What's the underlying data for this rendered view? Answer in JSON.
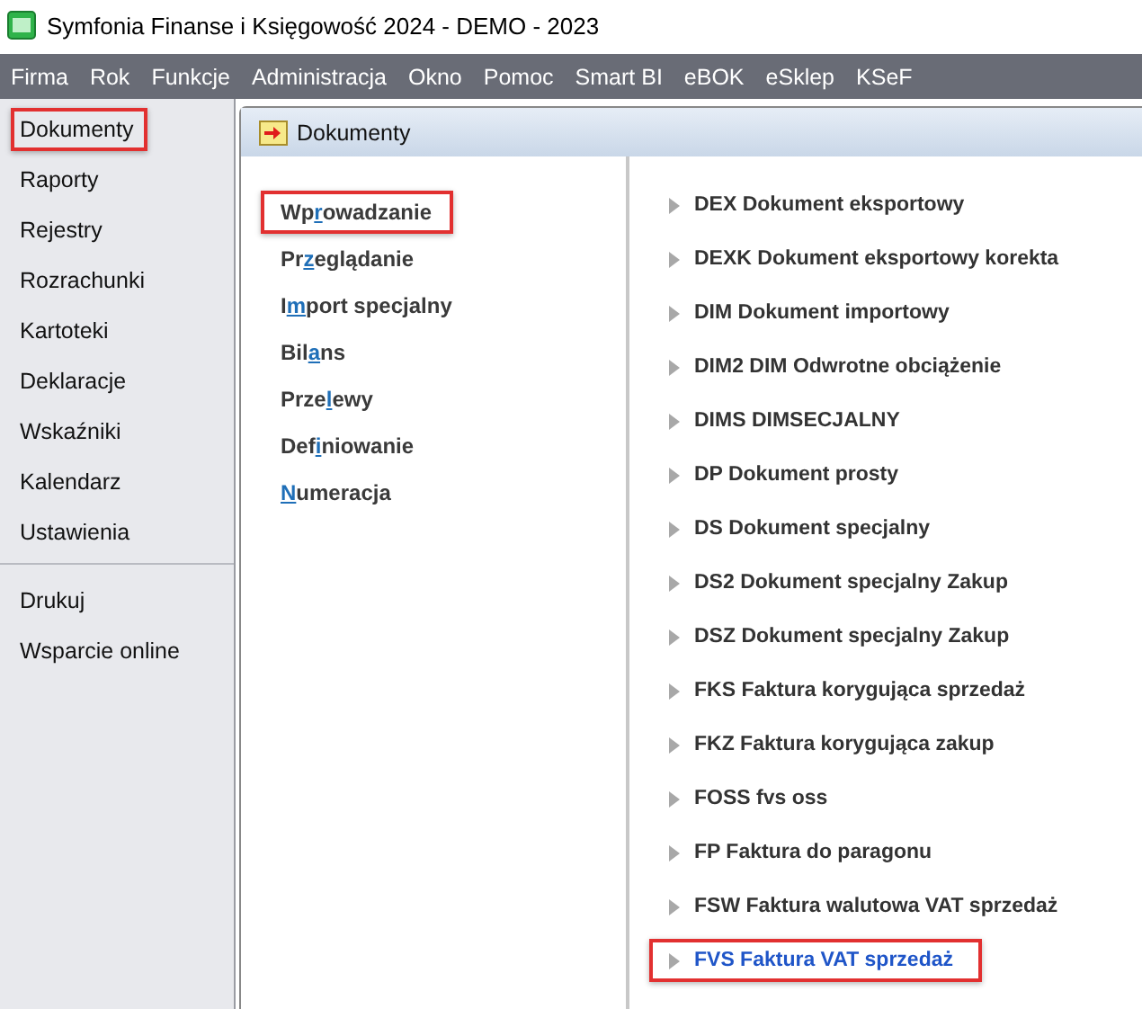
{
  "window": {
    "title": "Symfonia Finanse i Księgowość 2024 - DEMO - 2023"
  },
  "menu_bar": [
    "Firma",
    "Rok",
    "Funkcje",
    "Administracja",
    "Okno",
    "Pomoc",
    "Smart BI",
    "eBOK",
    "eSklep",
    "KSeF"
  ],
  "sidebar": {
    "groups": [
      [
        {
          "label": "Dokumenty",
          "highlighted": true
        },
        {
          "label": "Raporty",
          "highlighted": false
        },
        {
          "label": "Rejestry",
          "highlighted": false
        },
        {
          "label": "Rozrachunki",
          "highlighted": false
        },
        {
          "label": "Kartoteki",
          "highlighted": false
        },
        {
          "label": "Deklaracje",
          "highlighted": false
        },
        {
          "label": "Wskaźniki",
          "highlighted": false
        },
        {
          "label": "Kalendarz",
          "highlighted": false
        },
        {
          "label": "Ustawienia",
          "highlighted": false
        }
      ],
      [
        {
          "label": "Drukuj",
          "highlighted": false
        },
        {
          "label": "Wsparcie online",
          "highlighted": false
        }
      ]
    ]
  },
  "panel": {
    "title": "Dokumenty",
    "actions": [
      {
        "before": "Wp",
        "key": "r",
        "after": "owadzanie",
        "highlighted": true
      },
      {
        "before": "Pr",
        "key": "z",
        "after": "eglądanie",
        "highlighted": false
      },
      {
        "before": "I",
        "key": "m",
        "after": "port specjalny",
        "highlighted": false
      },
      {
        "before": "Bil",
        "key": "a",
        "after": "ns",
        "highlighted": false
      },
      {
        "before": "Prze",
        "key": "l",
        "after": "ewy",
        "highlighted": false
      },
      {
        "before": "Def",
        "key": "i",
        "after": "niowanie",
        "highlighted": false
      },
      {
        "key": "N",
        "after": "umeracja",
        "highlighted": false
      }
    ],
    "document_types": [
      {
        "label": "DEX Dokument eksportowy",
        "selected": false,
        "highlighted": false
      },
      {
        "label": "DEXK Dokument eksportowy korekta",
        "selected": false,
        "highlighted": false
      },
      {
        "label": "DIM Dokument importowy",
        "selected": false,
        "highlighted": false
      },
      {
        "label": "DIM2 DIM Odwrotne obciążenie",
        "selected": false,
        "highlighted": false
      },
      {
        "label": "DIMS DIMSECJALNY",
        "selected": false,
        "highlighted": false
      },
      {
        "label": "DP Dokument prosty",
        "selected": false,
        "highlighted": false
      },
      {
        "label": "DS Dokument specjalny",
        "selected": false,
        "highlighted": false
      },
      {
        "label": "DS2 Dokument specjalny Zakup",
        "selected": false,
        "highlighted": false
      },
      {
        "label": "DSZ Dokument specjalny Zakup",
        "selected": false,
        "highlighted": false
      },
      {
        "label": "FKS Faktura korygująca sprzedaż",
        "selected": false,
        "highlighted": false
      },
      {
        "label": "FKZ Faktura korygująca zakup",
        "selected": false,
        "highlighted": false
      },
      {
        "label": "FOSS fvs oss",
        "selected": false,
        "highlighted": false
      },
      {
        "label": "FP Faktura do paragonu",
        "selected": false,
        "highlighted": false
      },
      {
        "label": "FSW Faktura walutowa VAT sprzedaż",
        "selected": false,
        "highlighted": false
      },
      {
        "label": "FVS Faktura VAT sprzedaż",
        "selected": true,
        "highlighted": true
      }
    ]
  }
}
